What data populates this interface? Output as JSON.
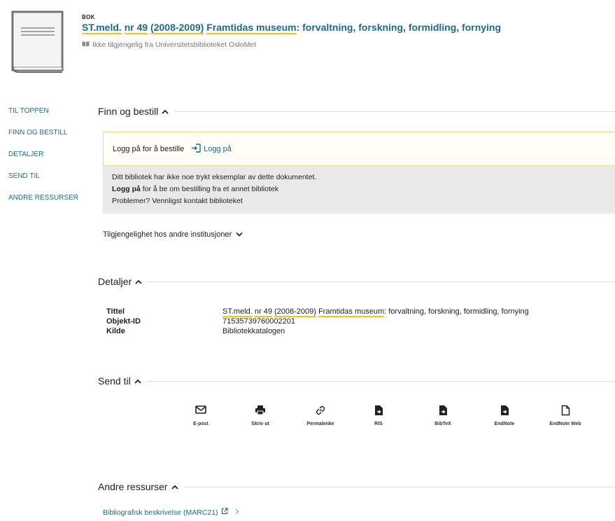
{
  "record": {
    "type": "BOK",
    "title_parts": [
      "ST.meld.",
      "nr 49",
      "(2008-2009)",
      "Framtidas museum",
      ": forvaltning, forskning, formidling, fornying"
    ],
    "availability": "Ikke tilgjengelig fra Universitetsbiblioteket OsloMet"
  },
  "sidenav": {
    "items": [
      "TIL TOPPEN",
      "FINN OG BESTILL",
      "DETALJER",
      "SEND TIL",
      "ANDRE RESSURSER"
    ]
  },
  "sections": {
    "finn": "Finn og bestill",
    "detaljer": "Detaljer",
    "send": "Send til",
    "andre": "Andre ressurser"
  },
  "finn": {
    "login_prompt": "Logg på for å bestille",
    "login_link": "Logg på",
    "info_line1": "Ditt bibliotek har ikke noe trykt eksemplar av dette dokumentet.",
    "info_line2_bold": "Logg på",
    "info_line2_rest": " for å be om bestilling fra et annet bibliotek",
    "info_line3": "Problemer? Vennligst kontakt biblioteket",
    "other_institutions": "Tilgjengelighet hos andre institusjoner"
  },
  "details": {
    "title_label": "Tittel",
    "title_parts": [
      "ST.meld.",
      "nr 49",
      "(2008-2009)",
      "Framtidas museum",
      ": forvaltning, forskning, formidling, fornying"
    ],
    "id_label": "Objekt-ID",
    "id_value": "71535739760002201",
    "source_label": "Kilde",
    "source_value": "Bibliotekkatalogen"
  },
  "send_to": [
    {
      "label": "E-post",
      "icon": "email-icon"
    },
    {
      "label": "Skriv ut",
      "icon": "print-icon"
    },
    {
      "label": "Permalenke",
      "icon": "link-icon"
    },
    {
      "label": "RIS",
      "icon": "file-export-icon"
    },
    {
      "label": "BibTeX",
      "icon": "file-export-icon"
    },
    {
      "label": "EndNote",
      "icon": "file-export-icon"
    },
    {
      "label": "EndNote Web",
      "icon": "file-outline-icon"
    }
  ],
  "andre": {
    "marc_link": "Bibliografisk beskrivelse (MARC21)"
  },
  "colors": {
    "link": "#1a6b8f",
    "highlight": "#f5c518",
    "info_bg": "#e9e9e9"
  }
}
